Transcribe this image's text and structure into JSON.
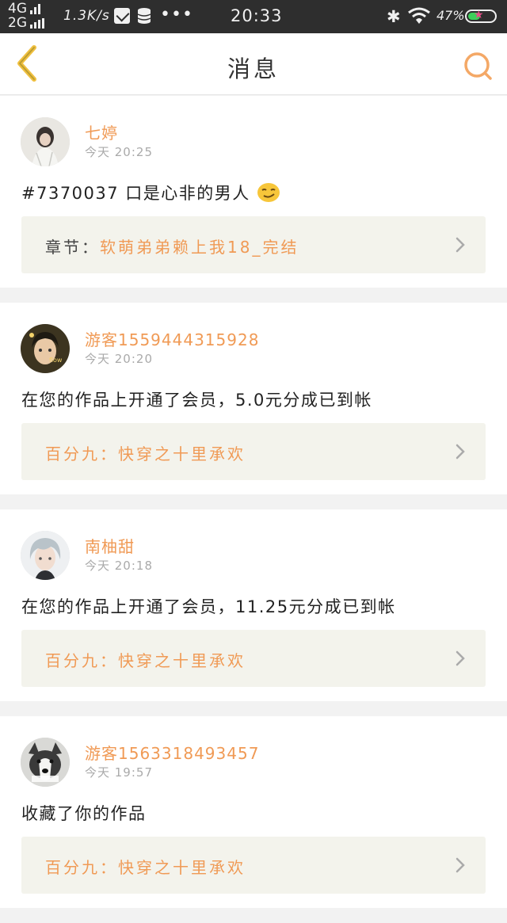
{
  "status_bar": {
    "net_top": "4G",
    "net_bottom": "2G",
    "speed": "1.3K/s",
    "dots": "•••",
    "time": "20:33",
    "battery": "47%",
    "battery_level_pct": 47
  },
  "header": {
    "title": "消息",
    "back_icon": "chevron-left-icon",
    "search_icon": "search-icon"
  },
  "messages": [
    {
      "name": "七婷",
      "time": "今天 20:25",
      "content": "#7370037 口是心非的男人",
      "has_emoji": true,
      "link_prefix": "章节：",
      "link_text": "软萌弟弟赖上我18_完结"
    },
    {
      "name": "游客1559444315928",
      "time": "今天 20:20",
      "content": "在您的作品上开通了会员，5.0元分成已到帐",
      "link_prefix": "",
      "link_text": "百分九：快穿之十里承欢"
    },
    {
      "name": "南柚甜",
      "time": "今天 20:18",
      "content": "在您的作品上开通了会员，11.25元分成已到帐",
      "link_prefix": "",
      "link_text": "百分九：快穿之十里承欢"
    },
    {
      "name": "游客1563318493457",
      "time": "今天 19:57",
      "content": "收藏了你的作品",
      "link_prefix": "",
      "link_text": "百分九：快穿之十里承欢"
    }
  ],
  "colors": {
    "accent": "#f09a55",
    "status_bar": "#2e2e2e",
    "link_bg": "#f3f3ec"
  }
}
